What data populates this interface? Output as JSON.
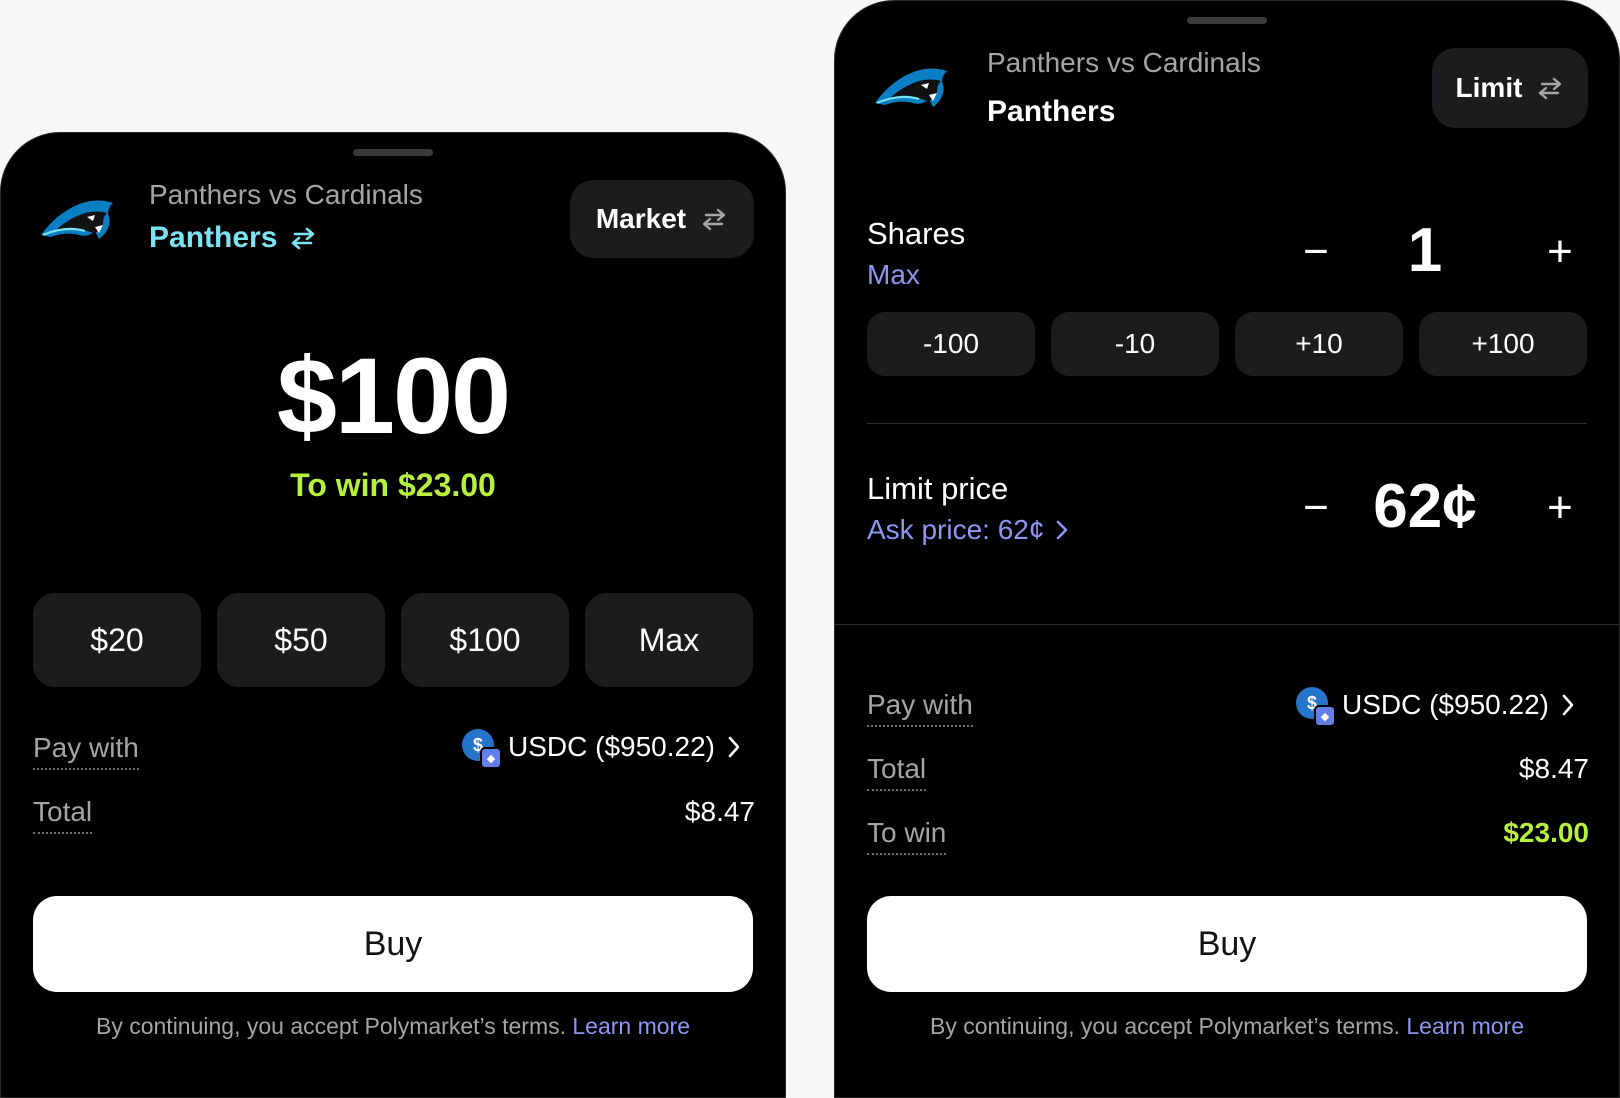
{
  "market_sheet": {
    "match": "Panthers vs Cardinals",
    "team": "Panthers",
    "mode_label": "Market",
    "amount": "$100",
    "to_win": "To win $23.00",
    "quick_amounts": [
      "$20",
      "$50",
      "$100",
      "Max"
    ],
    "pay_with_label": "Pay with",
    "pay_with_value": "USDC ($950.22)",
    "total_label": "Total",
    "total_value": "$8.47",
    "buy_label": "Buy",
    "terms_text": "By continuing, you accept Polymarket’s terms.",
    "learn_more": "Learn more"
  },
  "limit_sheet": {
    "match": "Panthers vs Cardinals",
    "team": "Panthers",
    "mode_label": "Limit",
    "shares_label": "Shares",
    "max_label": "Max",
    "shares_value": "1",
    "share_steps": [
      "-100",
      "-10",
      "+10",
      "+100"
    ],
    "limit_price_label": "Limit price",
    "ask_price": "Ask price: 62¢",
    "limit_price_value": "62¢",
    "pay_with_label": "Pay with",
    "pay_with_value": "USDC ($950.22)",
    "total_label": "Total",
    "total_value": "$8.47",
    "to_win_label": "To win",
    "to_win_value": "$23.00",
    "buy_label": "Buy",
    "terms_text": "By continuing, you accept Polymarket’s terms.",
    "learn_more": "Learn more"
  },
  "icons": {
    "team_logo": "panther-logo-icon",
    "swap": "swap-arrows-icon",
    "chevron": "chevron-right-icon",
    "usdc": "usdc-coin-icon"
  },
  "colors": {
    "background": "#000000",
    "accent_cyan": "#7ce3f2",
    "accent_green": "#b7f03d",
    "accent_purple": "#8d96f2",
    "chip": "#1c1c1e"
  }
}
